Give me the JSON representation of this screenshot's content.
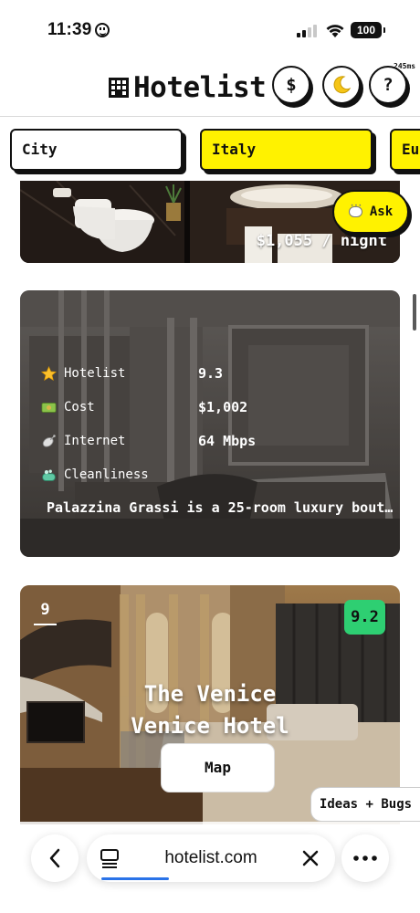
{
  "status_bar": {
    "time": "11:39",
    "battery": "100"
  },
  "header": {
    "logo_text": "Hotelist",
    "currency_symbol": "$",
    "theme_icon": "moon-icon",
    "help_symbol": "?",
    "latency": "245ms"
  },
  "filters": [
    {
      "label": "City",
      "active": false
    },
    {
      "label": "Italy",
      "active": true
    },
    {
      "label": "Eu",
      "active": true
    }
  ],
  "cards": [
    {
      "price": "$1,055 / night"
    },
    {
      "stats": [
        {
          "icon": "star-icon",
          "label": "Hotelist",
          "value": "9.3"
        },
        {
          "icon": "money-icon",
          "label": "Cost",
          "value": "$1,002"
        },
        {
          "icon": "satellite-icon",
          "label": "Internet",
          "value": "64 Mbps"
        },
        {
          "icon": "soap-icon",
          "label": "Cleanliness",
          "value": ""
        }
      ],
      "description": "Palazzina Grassi is a 25-room luxury bout…"
    },
    {
      "rank": "9",
      "score": "9.2",
      "name_line1": "The Venice",
      "name_line2": "Venice Hotel",
      "map_label": "Map"
    }
  ],
  "ask_label": "Ask",
  "ideas_label": "Ideas + Bugs",
  "browser": {
    "url": "hotelist.com"
  },
  "colors": {
    "accent_yellow": "#fff200",
    "score_green": "#2ecf72",
    "progress_blue": "#2a73e8"
  }
}
